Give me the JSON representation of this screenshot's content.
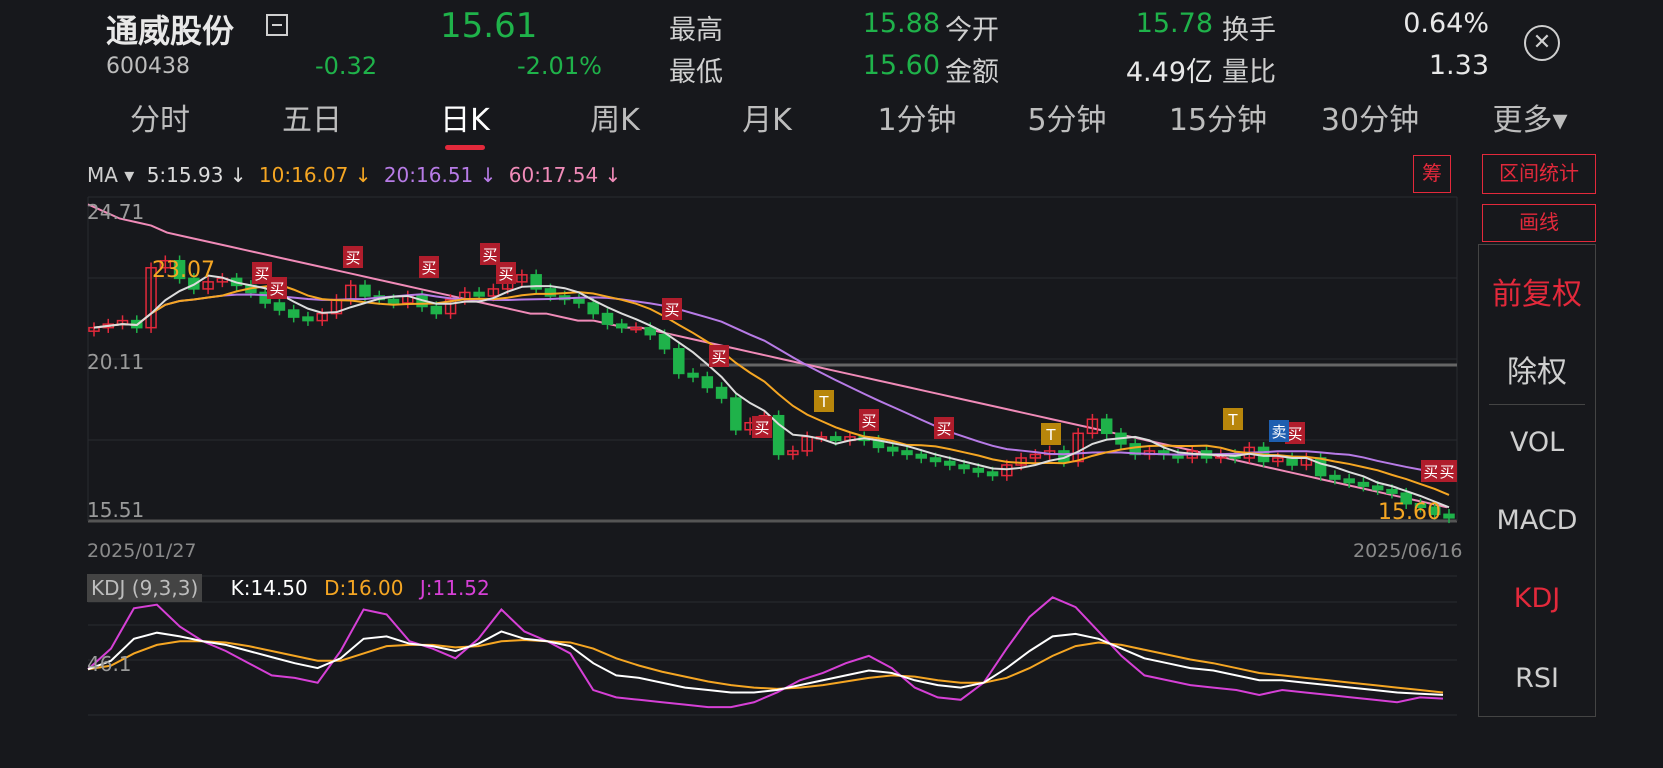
{
  "header": {
    "name": "通威股份",
    "code": "600438",
    "price": "15.61",
    "change": "-0.32",
    "change_pct": "-2.01%",
    "stats": [
      {
        "label": "最高",
        "value": "15.88",
        "color": "green"
      },
      {
        "label": "今开",
        "value": "15.78",
        "color": "green"
      },
      {
        "label": "换手",
        "value": "0.64%",
        "color": "white"
      },
      {
        "label": "最低",
        "value": "15.60",
        "color": "green"
      },
      {
        "label": "金额",
        "value": "4.49亿",
        "color": "white"
      },
      {
        "label": "量比",
        "value": "1.33",
        "color": "white"
      }
    ]
  },
  "tabs": [
    "分时",
    "五日",
    "日K",
    "周K",
    "月K",
    "1分钟",
    "5分钟",
    "15分钟",
    "30分钟",
    "更多▾"
  ],
  "active_tab": "日K",
  "ma": {
    "label": "MA ▾",
    "ma5": "5:15.93 ↓",
    "ma10": "10:16.07 ↓",
    "ma20": "20:16.51 ↓",
    "ma60": "60:17.54 ↓"
  },
  "colors": {
    "ma5": "#dcdcdc",
    "ma10": "#f5a623",
    "ma20": "#b77be6",
    "ma60": "#f08bb8",
    "up": "#e3293b",
    "down": "#1fb24a",
    "k": "#ffffff",
    "d": "#f5a623",
    "j": "#d640d6"
  },
  "buttons": {
    "chip": "筹",
    "range_stats": "区间统计",
    "draw": "画线"
  },
  "side_menu": [
    "前复权",
    "除权",
    "VOL",
    "MACD",
    "KDJ",
    "RSI"
  ],
  "chart_labels": {
    "y_top": "24.71",
    "y_mid": "20.11",
    "y_bottom": "15.51",
    "max_label": "23.07",
    "last_label": "15.60",
    "date_start": "2025/01/27",
    "date_end": "2025/06/16"
  },
  "markers": {
    "buy": "买",
    "sell": "卖",
    "t": "T"
  },
  "kdj": {
    "tag": "KDJ (9,3,3)",
    "k": "K:14.50",
    "d": "D:16.00",
    "j": "J:11.52",
    "level": "46.1"
  },
  "chart_data": {
    "type": "candlestick",
    "y_range": [
      15.51,
      24.71
    ],
    "close": [
      21.0,
      21.1,
      21.2,
      21.0,
      22.7,
      22.9,
      22.4,
      22.1,
      22.3,
      22.4,
      22.2,
      22.0,
      21.7,
      21.5,
      21.3,
      21.2,
      21.4,
      21.8,
      22.2,
      21.9,
      21.8,
      21.7,
      21.9,
      21.6,
      21.4,
      21.8,
      22.0,
      21.9,
      22.1,
      22.3,
      22.5,
      22.1,
      21.9,
      21.8,
      21.7,
      21.4,
      21.1,
      21.0,
      21.0,
      20.8,
      20.4,
      19.7,
      19.6,
      19.3,
      19.0,
      18.1,
      18.3,
      18.5,
      17.4,
      17.5,
      17.9,
      17.9,
      17.8,
      17.9,
      17.8,
      17.6,
      17.5,
      17.4,
      17.3,
      17.2,
      17.1,
      17.0,
      16.9,
      16.8,
      17.1,
      17.3,
      17.4,
      17.5,
      17.2,
      18.0,
      18.4,
      18.0,
      17.7,
      17.4,
      17.5,
      17.4,
      17.3,
      17.5,
      17.3,
      17.4,
      17.3,
      17.6,
      17.2,
      17.3,
      17.1,
      17.3,
      16.8,
      16.7,
      16.6,
      16.5,
      16.4,
      16.3,
      16.0,
      15.9,
      15.7,
      15.6
    ],
    "ma60": [
      24.5,
      24.3,
      24.1,
      24.0,
      23.9,
      23.7,
      23.6,
      23.5,
      23.4,
      23.3,
      23.2,
      23.1,
      23.0,
      22.9,
      22.8,
      22.7,
      22.6,
      22.5,
      22.4,
      22.3,
      22.2,
      22.1,
      22.0,
      21.9,
      21.8,
      21.7,
      21.6,
      21.5,
      21.4,
      21.4,
      21.3,
      21.2,
      21.2,
      21.1,
      21.0,
      21.0,
      20.9,
      20.8,
      20.7,
      20.6,
      20.5,
      20.4,
      20.3,
      20.2,
      20.1,
      20.0,
      19.9,
      19.8,
      19.7,
      19.6,
      19.5,
      19.4,
      19.3,
      19.2,
      19.1,
      19.0,
      18.9,
      18.8,
      18.7,
      18.6,
      18.5,
      18.4,
      18.3,
      18.2,
      18.1,
      18.0,
      17.9,
      17.8,
      17.7,
      17.6,
      17.5,
      17.4,
      17.3,
      17.2,
      17.1,
      17.0,
      16.9,
      16.8,
      16.7,
      16.6,
      16.5,
      16.4,
      16.3,
      16.2,
      16.1,
      16.0,
      15.9
    ],
    "kdj_k": [
      35,
      42,
      60,
      65,
      62,
      58,
      55,
      50,
      45,
      40,
      36,
      44,
      60,
      62,
      56,
      54,
      50,
      56,
      66,
      60,
      58,
      54,
      40,
      30,
      28,
      24,
      20,
      18,
      16,
      16,
      18,
      22,
      26,
      30,
      34,
      32,
      26,
      22,
      20,
      24,
      36,
      50,
      62,
      64,
      60,
      52,
      44,
      40,
      36,
      34,
      30,
      26,
      26,
      24,
      22,
      20,
      18,
      16,
      15,
      14
    ],
    "kdj_d": [
      35,
      38,
      48,
      55,
      58,
      58,
      57,
      54,
      50,
      46,
      42,
      42,
      48,
      54,
      55,
      55,
      53,
      54,
      58,
      59,
      58,
      57,
      52,
      44,
      38,
      33,
      29,
      25,
      22,
      20,
      19,
      20,
      22,
      25,
      28,
      30,
      29,
      26,
      24,
      24,
      28,
      36,
      46,
      54,
      57,
      55,
      51,
      47,
      43,
      40,
      36,
      32,
      30,
      28,
      26,
      24,
      22,
      20,
      18,
      16
    ],
    "kdj_j": [
      35,
      52,
      85,
      88,
      70,
      58,
      50,
      40,
      30,
      28,
      24,
      50,
      84,
      80,
      58,
      52,
      44,
      60,
      84,
      66,
      58,
      48,
      18,
      12,
      10,
      8,
      6,
      4,
      4,
      8,
      16,
      26,
      32,
      40,
      46,
      36,
      20,
      12,
      10,
      24,
      52,
      78,
      94,
      86,
      66,
      46,
      30,
      26,
      22,
      20,
      18,
      14,
      18,
      16,
      14,
      12,
      10,
      8,
      12,
      11
    ]
  }
}
